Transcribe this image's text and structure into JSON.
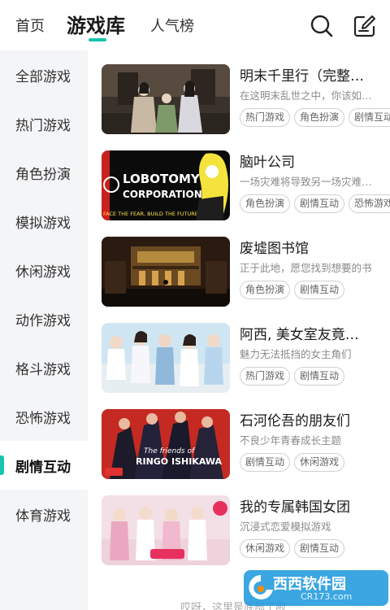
{
  "header": {
    "tabs": [
      {
        "label": "首页"
      },
      {
        "label": "游戏库"
      },
      {
        "label": "人气榜"
      }
    ],
    "accent_color": "#19c3b0"
  },
  "sidebar": {
    "items": [
      {
        "label": "全部游戏"
      },
      {
        "label": "热门游戏"
      },
      {
        "label": "角色扮演"
      },
      {
        "label": "模拟游戏"
      },
      {
        "label": "休闲游戏"
      },
      {
        "label": "动作游戏"
      },
      {
        "label": "格斗游戏"
      },
      {
        "label": "恐怖游戏"
      },
      {
        "label": "剧情互动",
        "active": true
      },
      {
        "label": "体育游戏"
      }
    ]
  },
  "games": [
    {
      "title": "明末千里行（完整…",
      "desc": "在这明末乱世之中，你该如…",
      "tags": [
        "热门游戏",
        "角色扮演",
        "剧情互动"
      ]
    },
    {
      "title": "脑叶公司",
      "desc": "一场灾难将导致另一场灾难…",
      "tags": [
        "角色扮演",
        "剧情互动",
        "恐怖游戏"
      ],
      "thumb_text": {
        "line1": "LOBOTOMY",
        "line2": "CORPORATION",
        "line3": "FACE THE FEAR, BUILD THE FUTURE"
      }
    },
    {
      "title": "废墟图书馆",
      "desc": "正于此地，愿您找到想要的书",
      "tags": [
        "角色扮演",
        "剧情互动"
      ]
    },
    {
      "title": "阿西, 美女室友竟…",
      "desc": "魅力无法抵挡的女主角们",
      "tags": [
        "热门游戏",
        "剧情互动"
      ]
    },
    {
      "title": "石河伦吾的朋友们",
      "desc": "不良少年青春成长主题",
      "tags": [
        "剧情互动",
        "休闲游戏"
      ],
      "thumb_text": {
        "line1": "The friends of",
        "line2": "RINGO ISHIKAWA"
      }
    },
    {
      "title": "我的专属韩国女团",
      "desc": "沉浸式恋爱模拟游戏",
      "tags": [
        "休闲游戏",
        "剧情互动"
      ]
    }
  ],
  "footer": {
    "text": "哎呀，这里是底部了啦"
  },
  "watermark": {
    "title": "西西软件园",
    "url": "CR173.com"
  }
}
